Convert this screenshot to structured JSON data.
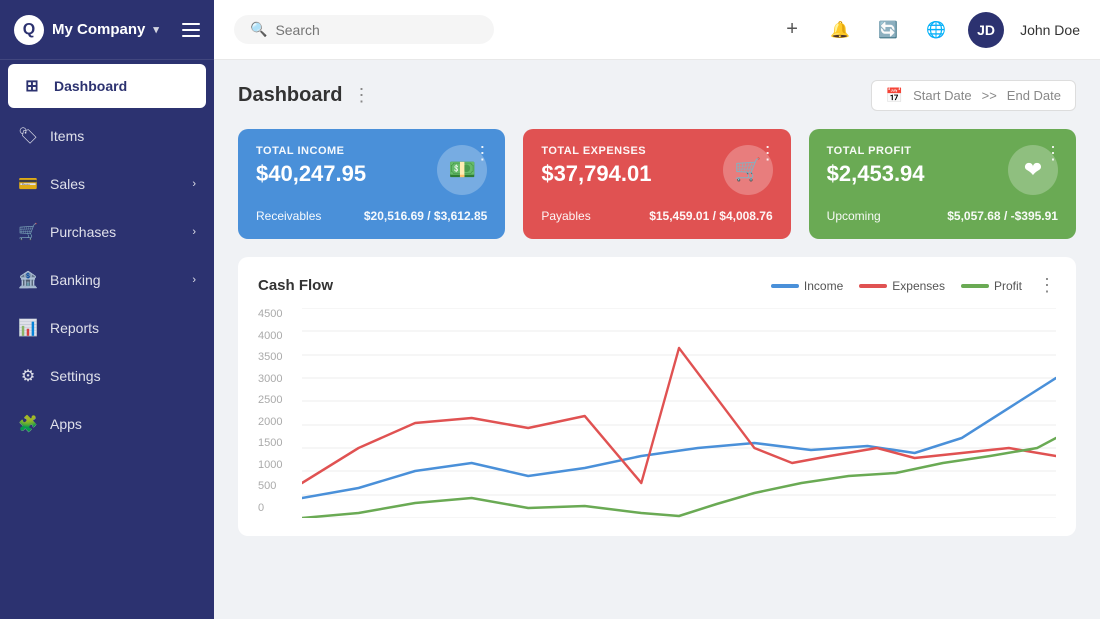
{
  "sidebar": {
    "company": "My Company",
    "nav_items": [
      {
        "id": "dashboard",
        "label": "Dashboard",
        "icon": "⊞",
        "active": true,
        "has_sub": false
      },
      {
        "id": "items",
        "label": "Items",
        "icon": "🏷",
        "active": false,
        "has_sub": false
      },
      {
        "id": "sales",
        "label": "Sales",
        "icon": "💳",
        "active": false,
        "has_sub": true
      },
      {
        "id": "purchases",
        "label": "Purchases",
        "icon": "🛒",
        "active": false,
        "has_sub": true
      },
      {
        "id": "banking",
        "label": "Banking",
        "icon": "🏦",
        "active": false,
        "has_sub": true
      },
      {
        "id": "reports",
        "label": "Reports",
        "icon": "📊",
        "active": false,
        "has_sub": false
      },
      {
        "id": "settings",
        "label": "Settings",
        "icon": "⚙",
        "active": false,
        "has_sub": false
      },
      {
        "id": "apps",
        "label": "Apps",
        "icon": "🧩",
        "active": false,
        "has_sub": false
      }
    ]
  },
  "topbar": {
    "search_placeholder": "Search",
    "user_name": "John Doe",
    "user_initials": "JD"
  },
  "dashboard": {
    "title": "Dashboard",
    "date_start": "Start Date",
    "date_end": "End Date",
    "date_separator": ">>",
    "stat_cards": [
      {
        "id": "income",
        "label": "TOTAL INCOME",
        "amount": "$40,247.95",
        "sub_label": "Receivables",
        "sub_value": "$20,516.69 / $3,612.85",
        "color": "blue",
        "icon": "💵"
      },
      {
        "id": "expenses",
        "label": "TOTAL EXPENSES",
        "amount": "$37,794.01",
        "sub_label": "Payables",
        "sub_value": "$15,459.01 / $4,008.76",
        "color": "red",
        "icon": "🛒"
      },
      {
        "id": "profit",
        "label": "TOTAL PROFIT",
        "amount": "$2,453.94",
        "sub_label": "Upcoming",
        "sub_value": "$5,057.68 / -$395.91",
        "color": "green",
        "icon": "❤"
      }
    ],
    "chart": {
      "title": "Cash Flow",
      "legend": [
        {
          "label": "Income",
          "color": "#4a90d9"
        },
        {
          "label": "Expenses",
          "color": "#e05252"
        },
        {
          "label": "Profit",
          "color": "#6aaa54"
        }
      ],
      "y_labels": [
        "4500",
        "4000",
        "3500",
        "3000",
        "2500",
        "2000",
        "1500",
        "1000",
        "500",
        "0"
      ]
    }
  }
}
